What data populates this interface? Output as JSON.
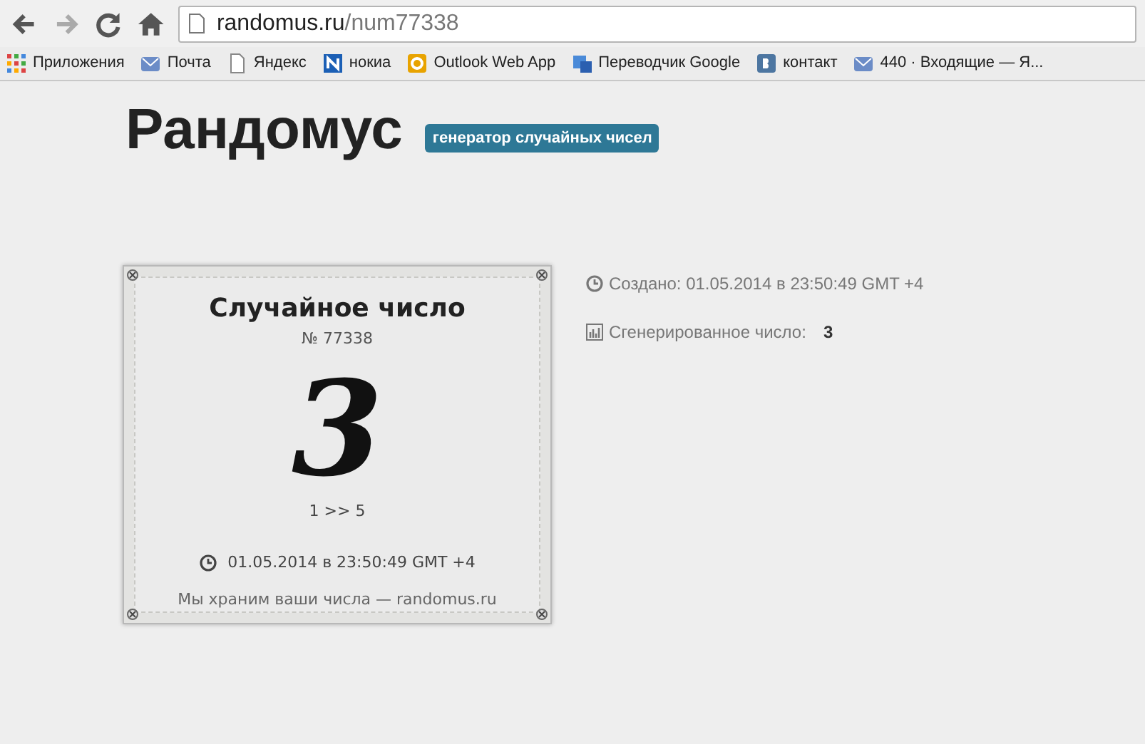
{
  "browser": {
    "url_host": "randomus.ru",
    "url_path": "/num77338",
    "bookmarks": [
      {
        "kind": "apps",
        "label": "Приложения"
      },
      {
        "kind": "mail",
        "label": "Почта"
      },
      {
        "kind": "page",
        "label": "Яндекс"
      },
      {
        "kind": "n",
        "label": "нокиа"
      },
      {
        "kind": "outlook",
        "label": "Outlook Web App"
      },
      {
        "kind": "translate",
        "label": "Переводчик Google"
      },
      {
        "kind": "vk",
        "label": "контакт"
      },
      {
        "kind": "mail",
        "label": "440 · Входящие — Я..."
      }
    ]
  },
  "header": {
    "title": "Рандомус",
    "badge": "генератор случайных чисел"
  },
  "card": {
    "title": "Случайное число",
    "number_label": "№ 77338",
    "value": "3",
    "range": "1 >> 5",
    "timestamp": "01.05.2014 в 23:50:49 GMT +4",
    "footer": "Мы храним ваши числа — randomus.ru"
  },
  "info": [
    {
      "kind": "clock",
      "label": "Создано: 01.05.2014 в 23:50:49 GMT +4"
    },
    {
      "kind": "chart",
      "label": "Сгенерированное число:",
      "value": "3"
    }
  ]
}
